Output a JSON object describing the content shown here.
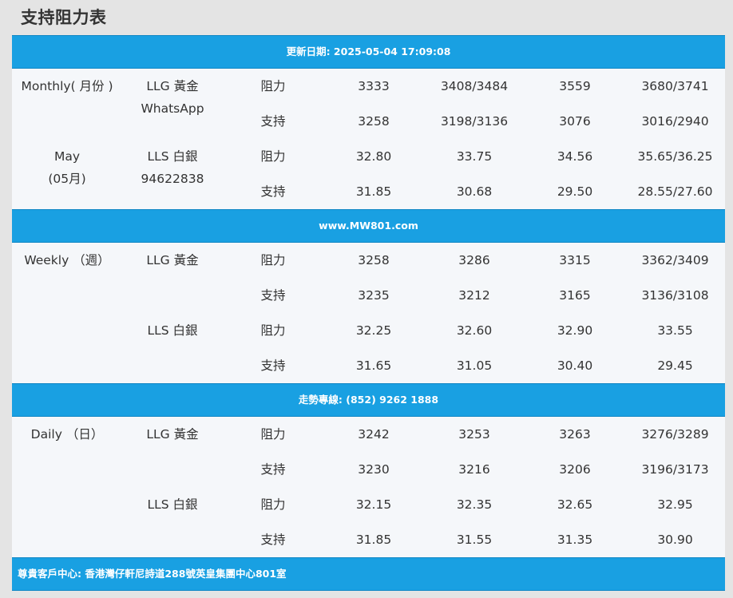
{
  "title": "支持阻力表",
  "banners": {
    "updated": "更新日期: 2025-05-04 17:09:08",
    "website": "www.MW801.com",
    "hotline": "走勢專線: (852) 9262 1888",
    "address": "尊貴客戶中心: 香港灣仔軒尼詩道288號英皇集團中心801室"
  },
  "monthly": {
    "period_line1": "Monthly( 月份 )",
    "period_line2": "May",
    "period_line3": "(05月)",
    "llg_label": "LLG 黃金",
    "llg_contact": "WhatsApp",
    "lls_label": "LLS 白銀",
    "lls_contact": "94622838",
    "rows": [
      {
        "type": "阻力",
        "v1": "3333",
        "v2": "3408/3484",
        "v3": "3559",
        "v4": "3680/3741"
      },
      {
        "type": "支持",
        "v1": "3258",
        "v2": "3198/3136",
        "v3": "3076",
        "v4": "3016/2940"
      },
      {
        "type": "阻力",
        "v1": "32.80",
        "v2": "33.75",
        "v3": "34.56",
        "v4": "35.65/36.25"
      },
      {
        "type": "支持",
        "v1": "31.85",
        "v2": "30.68",
        "v3": "29.50",
        "v4": "28.55/27.60"
      }
    ]
  },
  "weekly": {
    "period": "Weekly （週）",
    "llg_label": "LLG 黃金",
    "lls_label": "LLS 白銀",
    "rows": [
      {
        "type": "阻力",
        "v1": "3258",
        "v2": "3286",
        "v3": "3315",
        "v4": "3362/3409"
      },
      {
        "type": "支持",
        "v1": "3235",
        "v2": "3212",
        "v3": "3165",
        "v4": "3136/3108"
      },
      {
        "type": "阻力",
        "v1": "32.25",
        "v2": "32.60",
        "v3": "32.90",
        "v4": "33.55"
      },
      {
        "type": "支持",
        "v1": "31.65",
        "v2": "31.05",
        "v3": "30.40",
        "v4": "29.45"
      }
    ]
  },
  "daily": {
    "period": "Daily （日）",
    "llg_label": "LLG 黃金",
    "lls_label": "LLS 白銀",
    "rows": [
      {
        "type": "阻力",
        "v1": "3242",
        "v2": "3253",
        "v3": "3263",
        "v4": "3276/3289"
      },
      {
        "type": "支持",
        "v1": "3230",
        "v2": "3216",
        "v3": "3206",
        "v4": "3196/3173"
      },
      {
        "type": "阻力",
        "v1": "32.15",
        "v2": "32.35",
        "v3": "32.65",
        "v4": "32.95"
      },
      {
        "type": "支持",
        "v1": "31.85",
        "v2": "31.55",
        "v3": "31.35",
        "v4": "30.90"
      }
    ]
  },
  "colors": {
    "banner": "#19a0e2",
    "table_bg": "#f5f7fa",
    "page_bg": "#e4e4e4",
    "text": "#333333"
  }
}
